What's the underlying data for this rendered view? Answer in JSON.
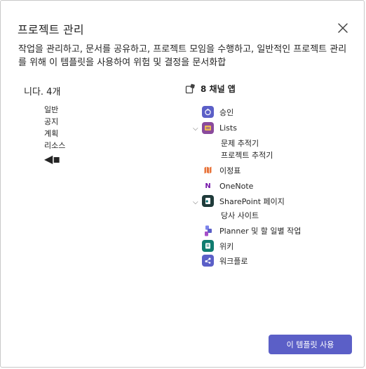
{
  "dialog": {
    "title": "프로젝트 관리",
    "description": "작업을 관리하고, 문서를 공유하고, 프로젝트 모임을 수행하고, 일반적인 프로젝트 관리를 위해 이 템플릿을 사용하여 위험 및 결정을 문서화합"
  },
  "channels": {
    "heading": "니다. 4개",
    "items": [
      "일반",
      "공지",
      "계획",
      "리소스"
    ]
  },
  "apps": {
    "heading": "8 채널 앱",
    "items": [
      {
        "label": "승인",
        "icon": "approvals-icon",
        "color": "#5b5fc7"
      },
      {
        "label": "Lists",
        "icon": "lists-icon",
        "color": "#8a4a9c",
        "sub": [
          "문제 추적기",
          "프로젝트 추적기"
        ]
      },
      {
        "label": "이정표",
        "icon": "milestones-icon",
        "color": "#ffffff"
      },
      {
        "label": "OneNote",
        "icon": "onenote-icon",
        "color": "#7719aa"
      },
      {
        "label": "SharePoint 페이지",
        "icon": "sharepoint-icon",
        "color": "#036c70",
        "sub": [
          "당사 사이트"
        ]
      },
      {
        "label": "Planner 및 할 일별 작업",
        "icon": "planner-icon",
        "color": "#7b83eb"
      },
      {
        "label": "위키",
        "icon": "wiki-icon",
        "color": "#107c6f"
      },
      {
        "label": "워크플로",
        "icon": "workflows-icon",
        "color": "#5b5fc7"
      }
    ]
  },
  "footer": {
    "use_template_label": "이 템플릿 사용"
  },
  "colors": {
    "accent": "#5b5fc7",
    "border": "#c8c8c8"
  }
}
